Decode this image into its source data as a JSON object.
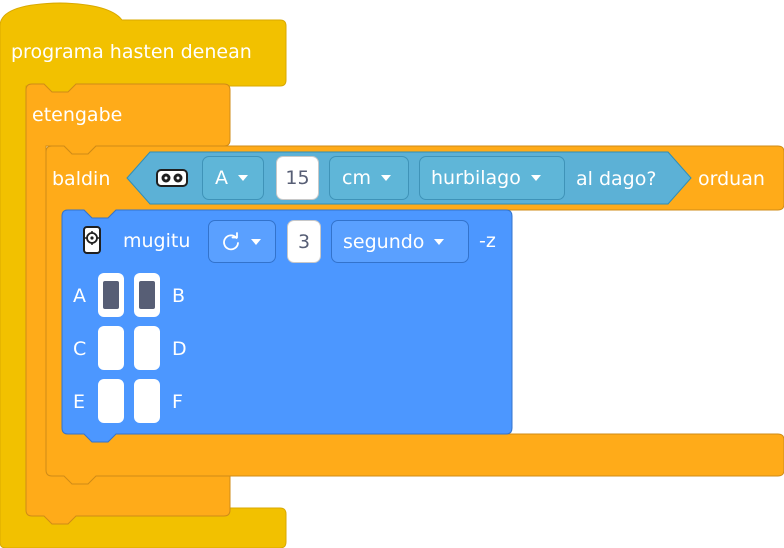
{
  "hat_block": {
    "label": "programa hasten denean"
  },
  "forever_block": {
    "label": "etengabe"
  },
  "if_block": {
    "label_if": "baldin",
    "label_then": "orduan"
  },
  "condition": {
    "sensor_icon": "distance-sensor-icon",
    "port_value": "A",
    "distance_value": "15",
    "unit_value": "cm",
    "comparison_value": "hurbilago",
    "suffix": "al dago?"
  },
  "move_block": {
    "motor_icon": "motor-icon",
    "label": "mugitu",
    "direction_icon": "clockwise-rotation-icon",
    "amount_value": "3",
    "unit_value": "segundo",
    "suffix": "-z"
  },
  "port_selector": {
    "ports": [
      {
        "label": "A",
        "selected": true
      },
      {
        "label": "B",
        "selected": true
      },
      {
        "label": "C",
        "selected": false
      },
      {
        "label": "D",
        "selected": false
      },
      {
        "label": "E",
        "selected": false
      },
      {
        "label": "F",
        "selected": false
      }
    ]
  },
  "colors": {
    "events": "#f0c000",
    "control": "#ffab19",
    "sensing": "#5cb1d6",
    "motion": "#4c97ff"
  }
}
